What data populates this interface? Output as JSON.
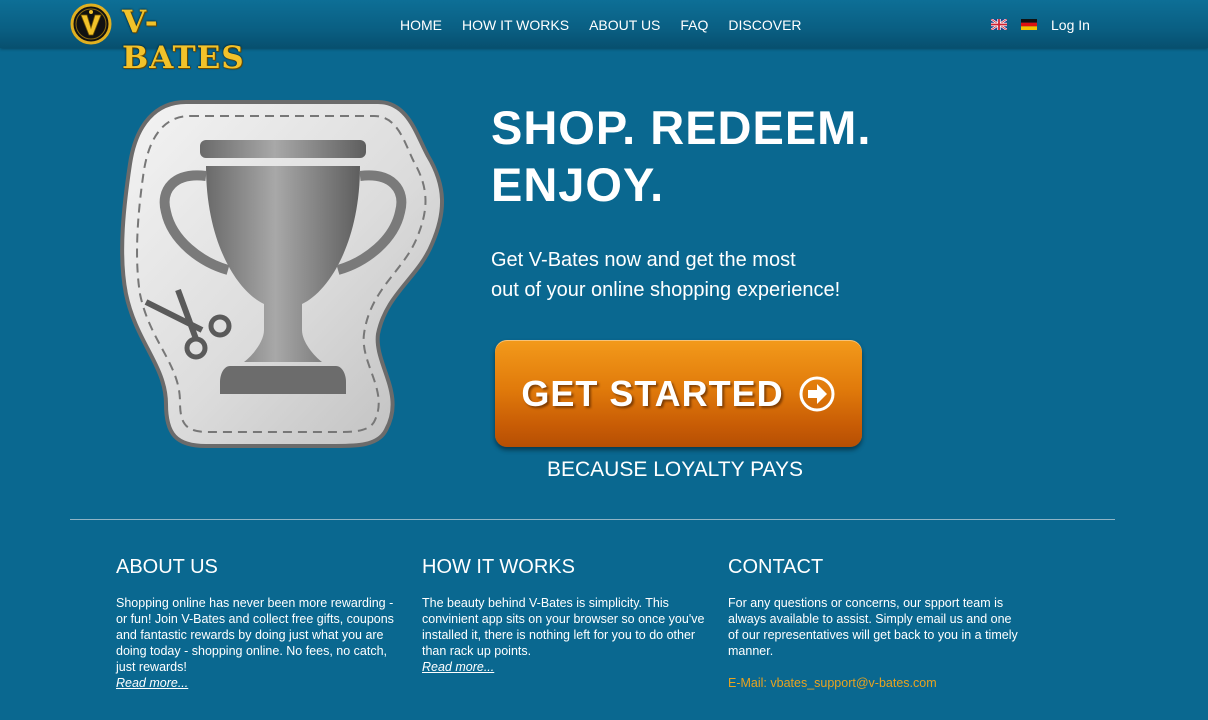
{
  "brand": {
    "name": "V-BATES"
  },
  "nav": {
    "items": [
      {
        "label": "HOME"
      },
      {
        "label": "HOW IT WORKS"
      },
      {
        "label": "ABOUT US"
      },
      {
        "label": "FAQ"
      },
      {
        "label": "DISCOVER"
      }
    ],
    "login_label": "Log In",
    "languages": [
      "uk-flag-icon",
      "germany-flag-icon"
    ]
  },
  "hero": {
    "title_line1": "SHOP. REDEEM.",
    "title_line2": "ENJOY.",
    "subtitle_line1": "Get V-Bates now and get the most",
    "subtitle_line2": "out of your online shopping experience!",
    "cta_label": "GET STARTED",
    "tagline": "BECAUSE LOYALTY PAYS",
    "illustration_icon": "trophy-coupon-icon"
  },
  "columns": [
    {
      "title": "ABOUT US",
      "text": "Shopping online has never been more rewarding - or fun! Join V-Bates and collect free gifts, coupons and fantastic rewards by doing just what you are doing today - shopping online. No fees, no catch, just rewards!",
      "link": "Read more..."
    },
    {
      "title": "HOW IT WORKS",
      "text": "The beauty behind V-Bates is simplicity. This convinient app sits on your browser so once you've installed it, there is nothing left for you to do other than rack up points.",
      "link": "Read more..."
    },
    {
      "title": "CONTACT",
      "text": "For any questions or concerns, our spport team is always available to assist. Simply email us and one of our representatives will get back to you in a timely manner.",
      "email": "E-Mail: vbates_support@v-bates.com"
    }
  ],
  "colors": {
    "background": "#0a6890",
    "cta_orange": "#e17b0b",
    "email_gold": "#e8a320",
    "logo_gold": "#f2c22a"
  }
}
